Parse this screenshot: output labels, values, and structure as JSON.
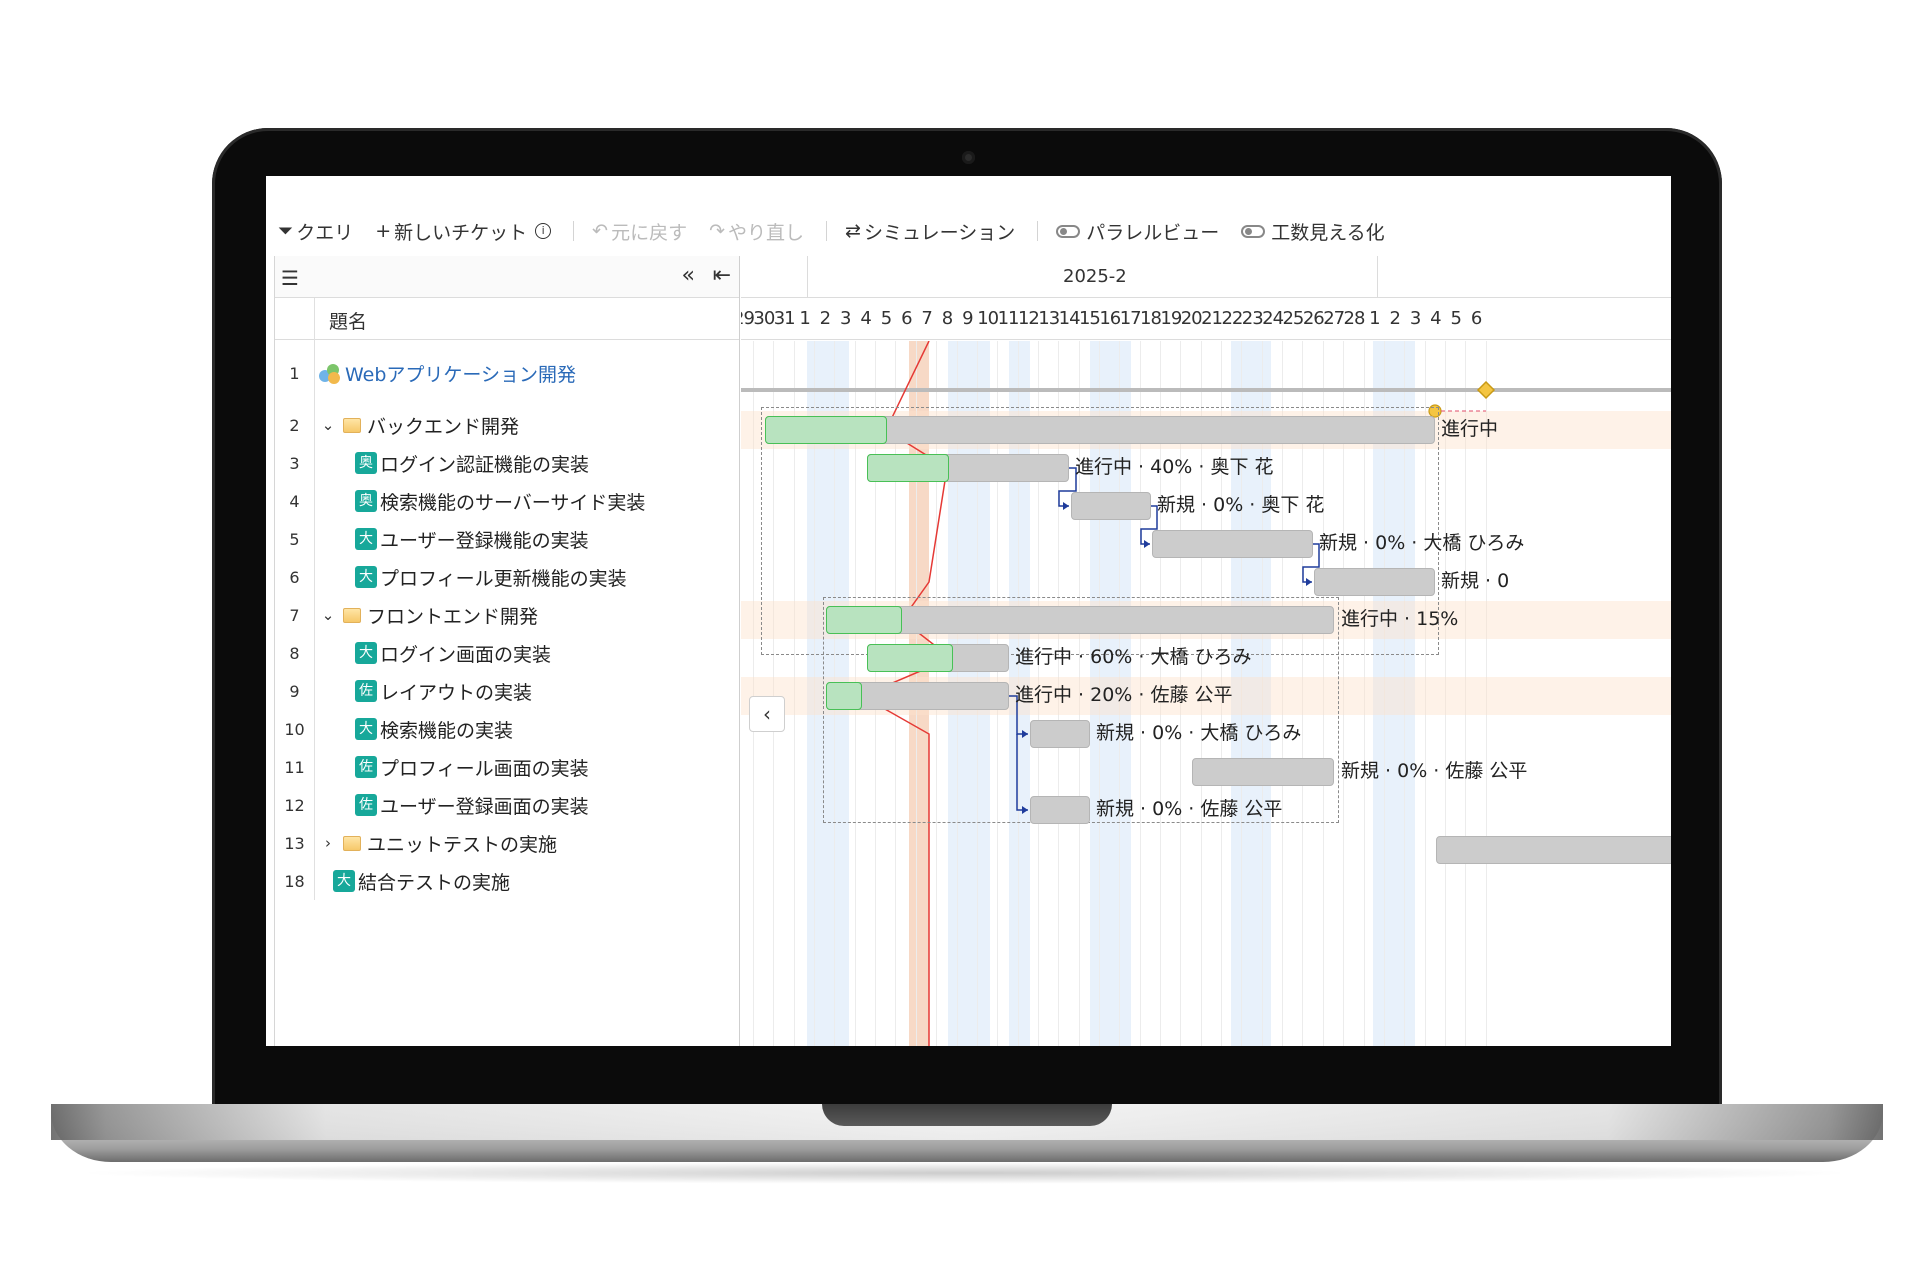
{
  "toolbar": {
    "query": "クエリ",
    "new_ticket": "新しいチケット",
    "undo": "元に戻す",
    "redo": "やり直し",
    "simulation": "シミュレーション",
    "parallel_view": "パラレルビュー",
    "workload": "工数見える化"
  },
  "grid": {
    "title_header": "題名"
  },
  "rows": [
    {
      "num": "1",
      "label": "Webアプリケーション開発"
    },
    {
      "num": "2",
      "label": "バックエンド開発"
    },
    {
      "num": "3",
      "avatar": "奥",
      "label": "ログイン認証機能の実装"
    },
    {
      "num": "4",
      "avatar": "奥",
      "label": "検索機能のサーバーサイド実装"
    },
    {
      "num": "5",
      "avatar": "大",
      "label": "ユーザー登録機能の実装"
    },
    {
      "num": "6",
      "avatar": "大",
      "label": "プロフィール更新機能の実装"
    },
    {
      "num": "7",
      "label": "フロントエンド開発"
    },
    {
      "num": "8",
      "avatar": "大",
      "label": "ログイン画面の実装"
    },
    {
      "num": "9",
      "avatar": "佐",
      "label": "レイアウトの実装"
    },
    {
      "num": "10",
      "avatar": "大",
      "label": "検索機能の実装"
    },
    {
      "num": "11",
      "avatar": "佐",
      "label": "プロフィール画面の実装"
    },
    {
      "num": "12",
      "avatar": "佐",
      "label": "ユーザー登録画面の実装"
    },
    {
      "num": "13",
      "label": "ユニットテストの実施"
    },
    {
      "num": "18",
      "avatar": "大",
      "label": "結合テストの実施"
    }
  ],
  "timeline": {
    "month": "2025-2",
    "days": [
      "29",
      "30",
      "31",
      "1",
      "2",
      "3",
      "4",
      "5",
      "6",
      "7",
      "8",
      "9",
      "10",
      "11",
      "12",
      "13",
      "14",
      "15",
      "16",
      "17",
      "18",
      "19",
      "20",
      "21",
      "22",
      "23",
      "24",
      "25",
      "26",
      "27",
      "28",
      "1",
      "2",
      "3",
      "4",
      "5",
      "6"
    ]
  },
  "bar_labels": {
    "row2": "進行中",
    "row3": "進行中 · 40% · 奥下 花",
    "row4": "新規 · 0% · 奥下 花",
    "row5": "新規 · 0% · 大橋 ひろみ",
    "row6": "新規 · 0",
    "row7": "進行中 · 15%",
    "row8": "進行中 · 60% · 大橋 ひろみ",
    "row9": "進行中 · 20% · 佐藤 公平",
    "row10": "新規 · 0% · 大橋 ひろみ",
    "row11": "新規 · 0% · 佐藤 公平",
    "row12": "新規 · 0% · 佐藤 公平"
  },
  "colors": {
    "avatar": "#17a89a",
    "progress": "#b8e3bf",
    "bar": "#cccccc",
    "today": "#f7d9c6",
    "dependency": "#1f3c9c",
    "lightning": "#e53935"
  }
}
